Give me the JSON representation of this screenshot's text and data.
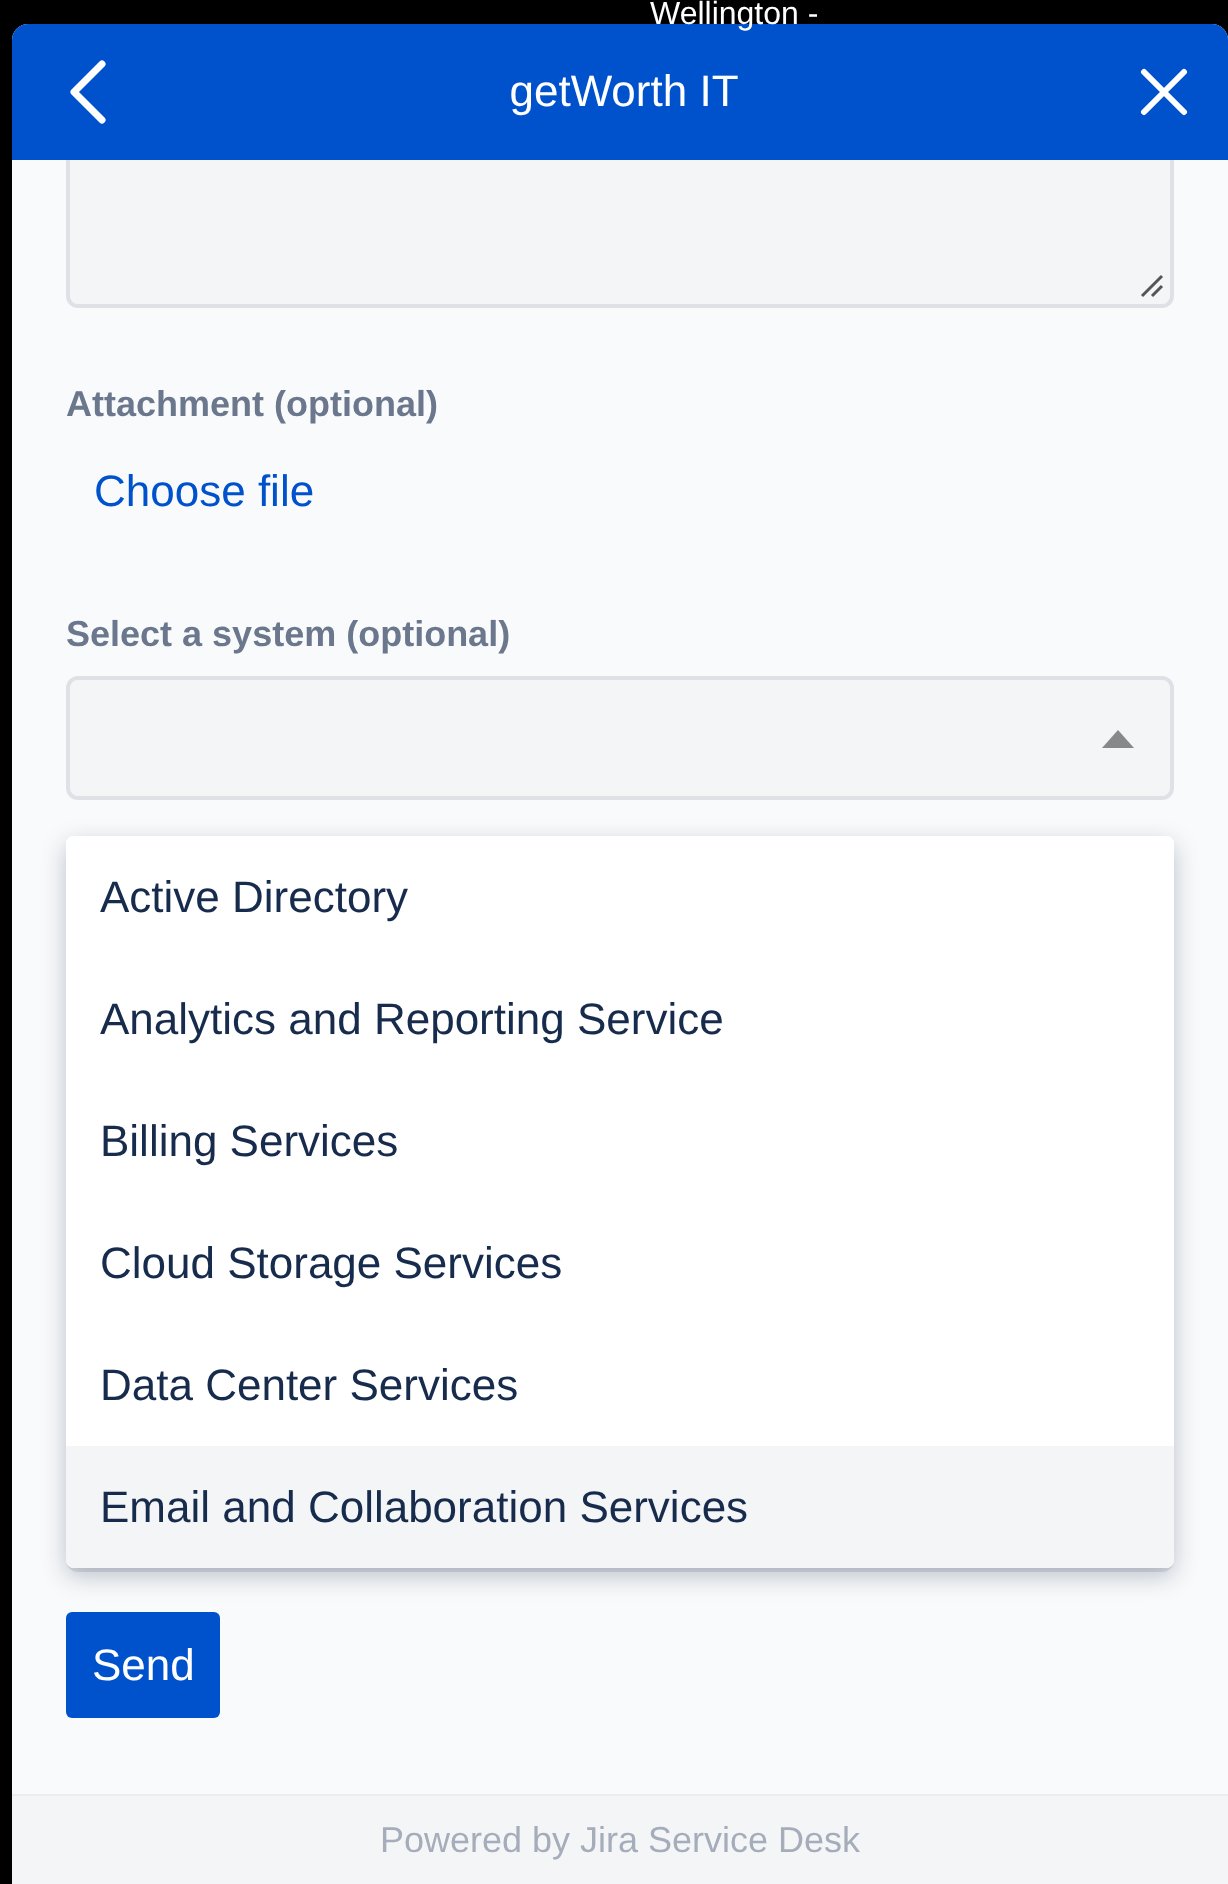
{
  "background_label": "Wellington -",
  "header": {
    "title": "getWorth IT"
  },
  "attachment": {
    "label": "Attachment (optional)",
    "link": "Choose file"
  },
  "system": {
    "label": "Select a system (optional)",
    "expanded": true,
    "options": [
      {
        "label": "Active Directory",
        "selected": false
      },
      {
        "label": "Analytics and Reporting Service",
        "selected": false
      },
      {
        "label": "Billing Services",
        "selected": false
      },
      {
        "label": "Cloud Storage Services",
        "selected": false
      },
      {
        "label": "Data Center Services",
        "selected": false
      },
      {
        "label": "Email and Collaboration Services",
        "selected": true
      }
    ]
  },
  "send_button": "Send",
  "footer": "Powered by Jira Service Desk"
}
